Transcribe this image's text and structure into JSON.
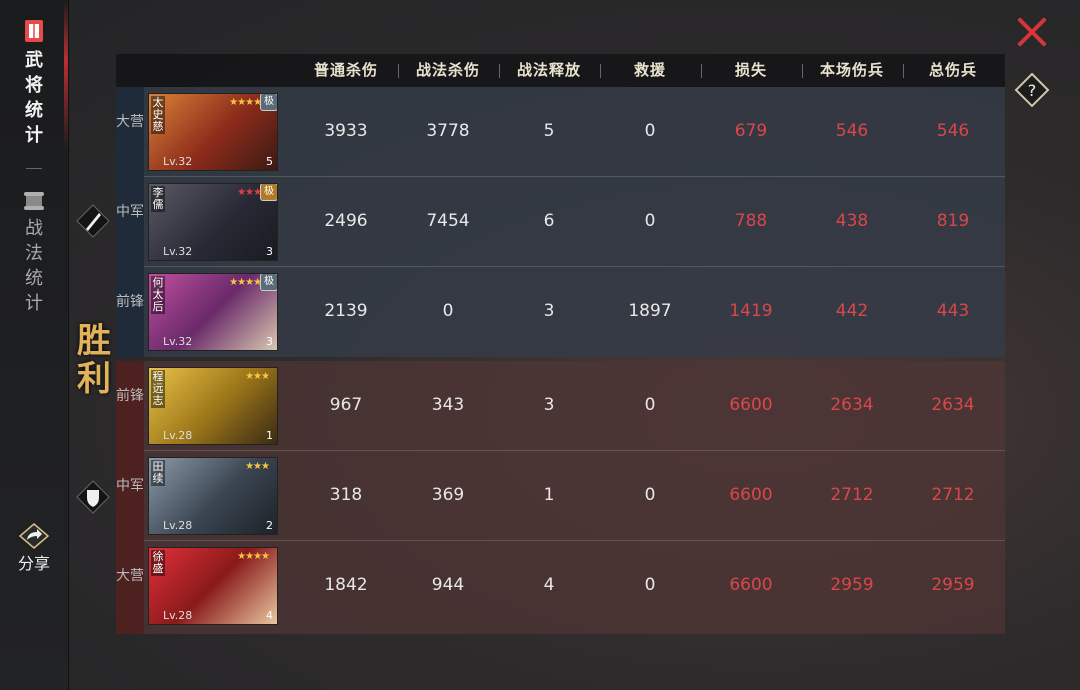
{
  "sidebar": {
    "tabs": [
      {
        "label": "武将统计",
        "active": true
      },
      {
        "label": "战法统计",
        "active": false
      }
    ],
    "share_label": "分享"
  },
  "victory_text": "胜利",
  "headers": [
    "普通杀伤",
    "战法杀伤",
    "战法释放",
    "救援",
    "损失",
    "本场伤兵",
    "总伤兵"
  ],
  "top_team": {
    "rows": [
      {
        "position": "大营",
        "name": "太史慈",
        "level": "Lv.32",
        "stars": "★★★★★",
        "badge": "极",
        "count": "5",
        "normal": "3933",
        "tactic": "3778",
        "release": "5",
        "rescue": "0",
        "loss": "679",
        "wounded": "546",
        "total": "546"
      },
      {
        "position": "中军",
        "name": "李儒",
        "level": "Lv.32",
        "stars": "★★★★",
        "badge": "极",
        "count": "3",
        "normal": "2496",
        "tactic": "7454",
        "release": "6",
        "rescue": "0",
        "loss": "788",
        "wounded": "438",
        "total": "819"
      },
      {
        "position": "前锋",
        "name": "何太后",
        "level": "Lv.32",
        "stars": "★★★★★",
        "badge": "极",
        "count": "3",
        "normal": "2139",
        "tactic": "0",
        "release": "3",
        "rescue": "1897",
        "loss": "1419",
        "wounded": "442",
        "total": "443"
      }
    ]
  },
  "bottom_team": {
    "rows": [
      {
        "position": "前锋",
        "name": "程远志",
        "level": "Lv.28",
        "stars": "★★★",
        "count": "1",
        "normal": "967",
        "tactic": "343",
        "release": "3",
        "rescue": "0",
        "loss": "6600",
        "wounded": "2634",
        "total": "2634"
      },
      {
        "position": "中军",
        "name": "田续",
        "level": "Lv.28",
        "stars": "★★★",
        "count": "2",
        "normal": "318",
        "tactic": "369",
        "release": "1",
        "rescue": "0",
        "loss": "6600",
        "wounded": "2712",
        "total": "2712"
      },
      {
        "position": "大营",
        "name": "徐盛",
        "level": "Lv.28",
        "stars": "★★★★",
        "count": "4",
        "normal": "1842",
        "tactic": "944",
        "release": "4",
        "rescue": "0",
        "loss": "6600",
        "wounded": "2959",
        "total": "2959"
      }
    ]
  },
  "colors": {
    "red_value": "#d9474a",
    "header_text": "#e9e2cf",
    "gold": "#e2b25a"
  }
}
